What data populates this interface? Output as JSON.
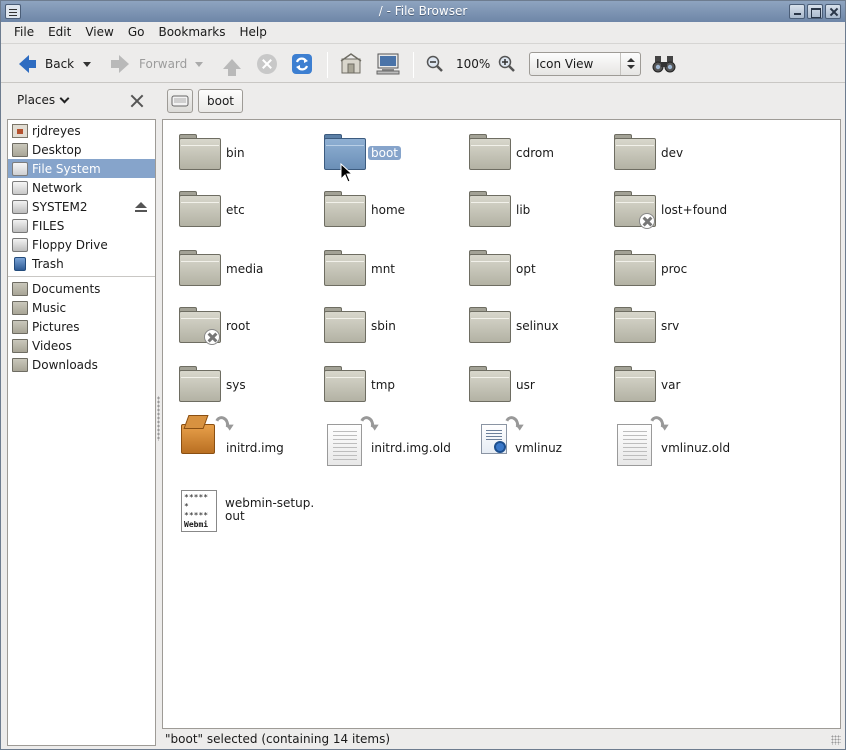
{
  "window": {
    "title": "/ - File Browser"
  },
  "menubar": [
    {
      "label": "File"
    },
    {
      "label": "Edit"
    },
    {
      "label": "View"
    },
    {
      "label": "Go"
    },
    {
      "label": "Bookmarks"
    },
    {
      "label": "Help"
    }
  ],
  "toolbar": {
    "back_label": "Back",
    "forward_label": "Forward",
    "zoom": "100%",
    "view_mode": "Icon View"
  },
  "location": {
    "sidebar_title": "Places",
    "current": "boot"
  },
  "sidebar": {
    "places": [
      {
        "label": "rjdreyes",
        "icon": "home-folder-icon"
      },
      {
        "label": "Desktop",
        "icon": "folder-icon"
      },
      {
        "label": "File System",
        "icon": "filesystem-icon",
        "selected": true
      },
      {
        "label": "Network",
        "icon": "network-icon"
      },
      {
        "label": "SYSTEM2",
        "icon": "drive-icon",
        "eject": true
      },
      {
        "label": "FILES",
        "icon": "drive-icon"
      },
      {
        "label": "Floppy Drive",
        "icon": "floppy-icon"
      },
      {
        "label": "Trash",
        "icon": "trash-icon"
      }
    ],
    "bookmarks": [
      {
        "label": "Documents",
        "icon": "folder-icon"
      },
      {
        "label": "Music",
        "icon": "folder-icon"
      },
      {
        "label": "Pictures",
        "icon": "folder-icon"
      },
      {
        "label": "Videos",
        "icon": "folder-icon"
      },
      {
        "label": "Downloads",
        "icon": "folder-icon"
      }
    ]
  },
  "files": [
    {
      "name": "bin",
      "type": "folder"
    },
    {
      "name": "boot",
      "type": "folder",
      "selected": true
    },
    {
      "name": "cdrom",
      "type": "folder"
    },
    {
      "name": "dev",
      "type": "folder"
    },
    {
      "name": "etc",
      "type": "folder"
    },
    {
      "name": "home",
      "type": "folder"
    },
    {
      "name": "lib",
      "type": "folder"
    },
    {
      "name": "lost+found",
      "type": "folder-noaccess"
    },
    {
      "name": "media",
      "type": "folder"
    },
    {
      "name": "mnt",
      "type": "folder"
    },
    {
      "name": "opt",
      "type": "folder"
    },
    {
      "name": "proc",
      "type": "folder"
    },
    {
      "name": "root",
      "type": "folder-noaccess"
    },
    {
      "name": "sbin",
      "type": "folder"
    },
    {
      "name": "selinux",
      "type": "folder"
    },
    {
      "name": "srv",
      "type": "folder"
    },
    {
      "name": "sys",
      "type": "folder"
    },
    {
      "name": "tmp",
      "type": "folder"
    },
    {
      "name": "usr",
      "type": "folder"
    },
    {
      "name": "var",
      "type": "folder"
    },
    {
      "name": "initrd.img",
      "type": "package-link"
    },
    {
      "name": "initrd.img.old",
      "type": "document-link"
    },
    {
      "name": "vmlinuz",
      "type": "executable-link"
    },
    {
      "name": "vmlinuz.old",
      "type": "document-link"
    },
    {
      "name": "webmin-setup.\nout",
      "type": "script",
      "icon_text": "Webmi"
    }
  ],
  "status": "\"boot\" selected (containing 14 items)"
}
